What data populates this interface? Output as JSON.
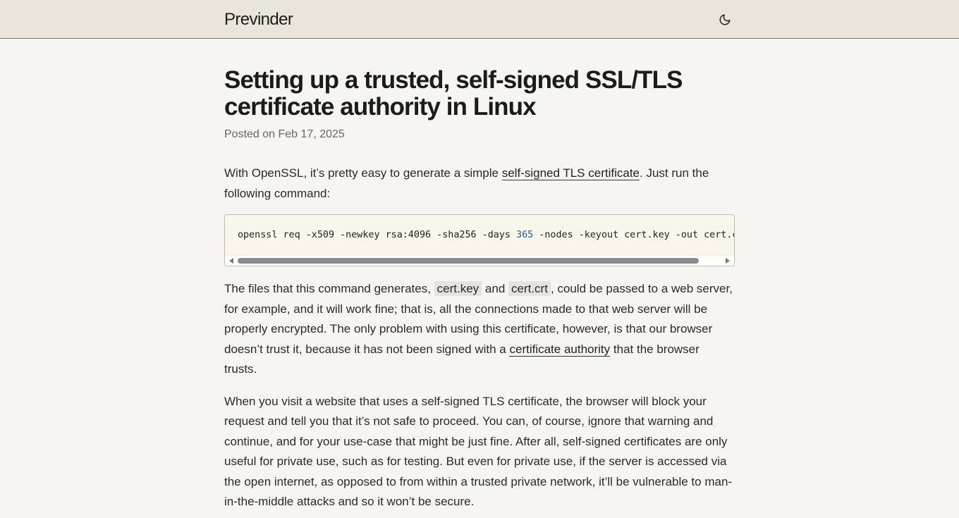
{
  "header": {
    "site_title": "Previnder",
    "theme_icon": "moon-icon"
  },
  "post": {
    "title": "Setting up a trusted, self-signed SSL/TLS certificate authority in Linux",
    "date": "Posted on Feb 17, 2025"
  },
  "p1": {
    "before": "With OpenSSL, it’s pretty easy to generate a simple ",
    "link": "self-signed TLS certificate",
    "after": ". Just run the following command:"
  },
  "code": {
    "before_num": "openssl req -x509 -newkey rsa:4096 -sha256 -days ",
    "num": "365",
    "after_num": " -nodes -keyout cert.key -out cert.crt"
  },
  "p2": {
    "part1": "The files that this command generates, ",
    "code1": "cert.key",
    "part2": " and ",
    "code2": "cert.crt",
    "part3": ", could be passed to a web server, for example, and it will work fine; that is, all the connections made to that web server will be properly encrypted. The only problem with using this certificate, however, is that our browser doesn’t trust it, because it has not been signed with a ",
    "link": "certificate authority",
    "part4": " that the browser trusts."
  },
  "p3": {
    "text": "When you visit a website that uses a self-signed TLS certificate, the browser will block your request and tell you that it’s not safe to proceed. You can, of course, ignore that warning and continue, and for your use-case that might be just fine. After all, self-signed certificates are only useful for private use, such as for testing. But even for private use, if the server is accessed via the open internet, as opposed to from within a trusted private network, it’ll be vulnerable to man-in-the-middle attacks and so it won’t be secure."
  }
}
